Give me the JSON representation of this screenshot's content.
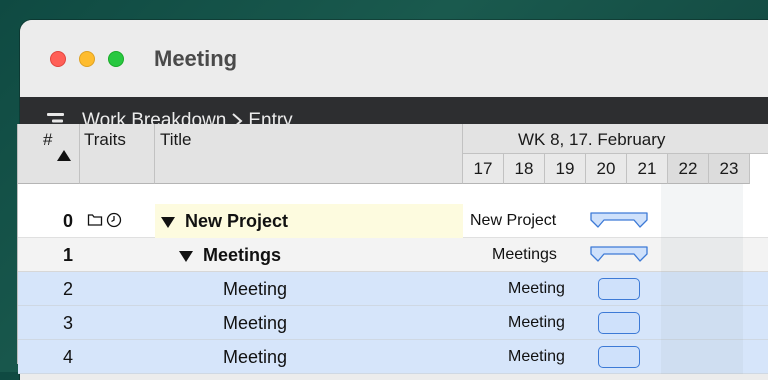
{
  "window": {
    "title": "Meeting"
  },
  "toolbar": {
    "icon": "wbs-outline-icon",
    "breadcrumb": [
      {
        "label": "Work Breakdown"
      },
      {
        "label": "Entry"
      }
    ]
  },
  "table": {
    "columns": {
      "num": "#",
      "traits": "Traits",
      "title": "Title"
    },
    "week_label": "WK 8, 17. February",
    "days": [
      "17",
      "18",
      "19",
      "20",
      "21",
      "22",
      "23"
    ],
    "rows": [
      {
        "num": "0",
        "title": "New Project",
        "gantt_label": "New Project",
        "traits": [
          "folder-icon",
          "clock-icon"
        ]
      },
      {
        "num": "1",
        "title": "Meetings",
        "gantt_label": "Meetings"
      },
      {
        "num": "2",
        "title": "Meeting",
        "gantt_label": "Meeting"
      },
      {
        "num": "3",
        "title": "Meeting",
        "gantt_label": "Meeting"
      },
      {
        "num": "4",
        "title": "Meeting",
        "gantt_label": "Meeting"
      }
    ]
  },
  "colors": {
    "task_bar_border": "#3d7ad6",
    "task_row": "#d6e5fa",
    "project_title_bg": "#fdfbdf"
  }
}
